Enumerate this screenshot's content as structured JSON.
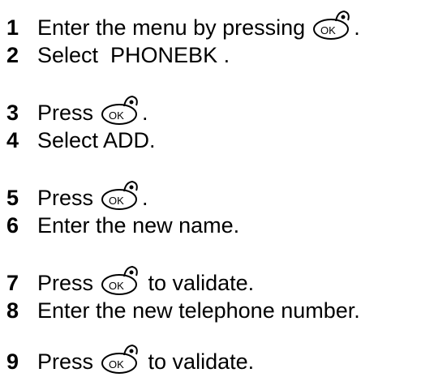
{
  "steps": [
    {
      "num": "1",
      "before": "Enter the menu by pressing",
      "button": "OK",
      "after": "."
    },
    {
      "num": "2",
      "text": "Select  PHONEBK ."
    },
    {
      "num": "3",
      "before": "Press",
      "button": "OK",
      "after": "."
    },
    {
      "num": "4",
      "text": "Select ADD."
    },
    {
      "num": "5",
      "before": "Press",
      "button": "OK",
      "after": "."
    },
    {
      "num": "6",
      "text": "Enter the new name."
    },
    {
      "num": "7",
      "before": "Press",
      "button": "OK",
      "after": " to validate."
    },
    {
      "num": "8",
      "text": "Enter the new telephone number."
    },
    {
      "num": "9",
      "before": "Press",
      "button": "OK",
      "after": " to validate."
    }
  ],
  "icon_name": "ok-button-icon"
}
